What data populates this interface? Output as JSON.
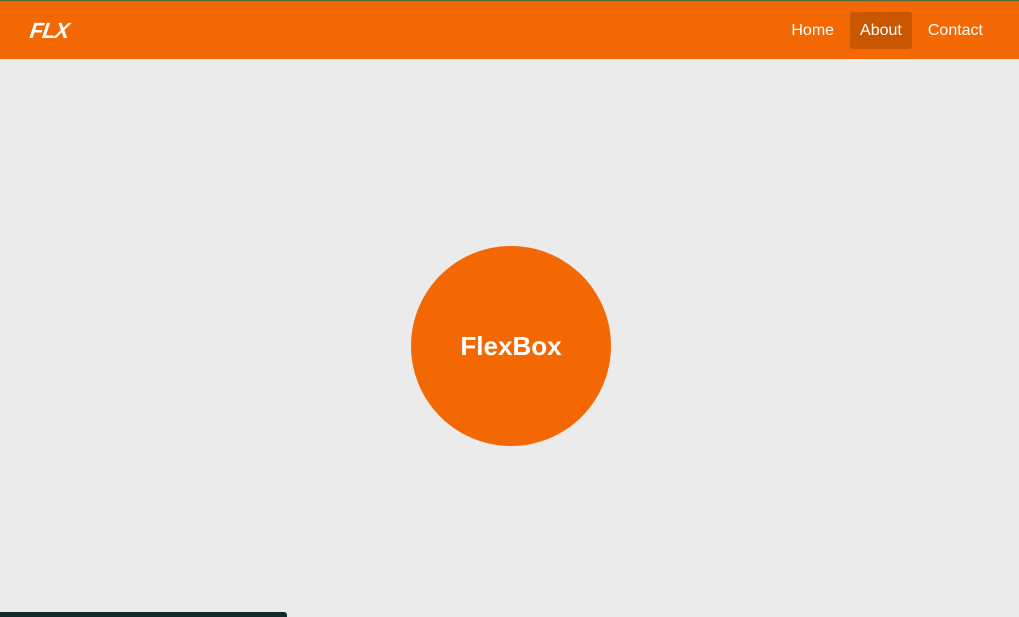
{
  "header": {
    "logo_text": "FLX",
    "nav": [
      {
        "label": "Home",
        "active": false
      },
      {
        "label": "About",
        "active": true
      },
      {
        "label": "Contact",
        "active": false
      }
    ]
  },
  "main": {
    "circle_label": "FlexBox"
  },
  "colors": {
    "brand": "#f36802",
    "nav_active": "#c95700",
    "background": "#ebebeb",
    "text_on_brand": "#ffffff"
  }
}
